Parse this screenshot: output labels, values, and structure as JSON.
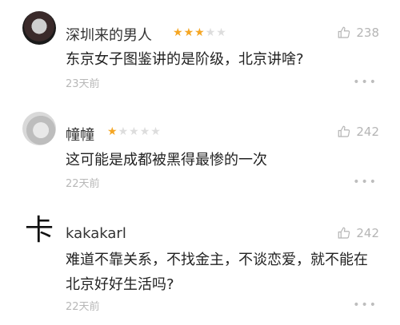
{
  "comments": [
    {
      "user": "深圳来的男人",
      "stars_filled": 3,
      "stars_total": 5,
      "likes": "238",
      "text": "东京女子图鉴讲的是阶级，北京讲啥?",
      "time": "23天前"
    },
    {
      "user": "幢幢",
      "stars_filled": 1,
      "stars_total": 5,
      "likes": "242",
      "text": "这可能是成都被黑得最惨的一次",
      "time": "22天前"
    },
    {
      "user": "kakakarl",
      "avatar_glyph": "卡",
      "likes": "242",
      "text": "难道不靠关系，不找金主，不谈恋爱，就不能在北京好好生活吗?",
      "time": "22天前"
    }
  ],
  "more_glyph": "•••"
}
